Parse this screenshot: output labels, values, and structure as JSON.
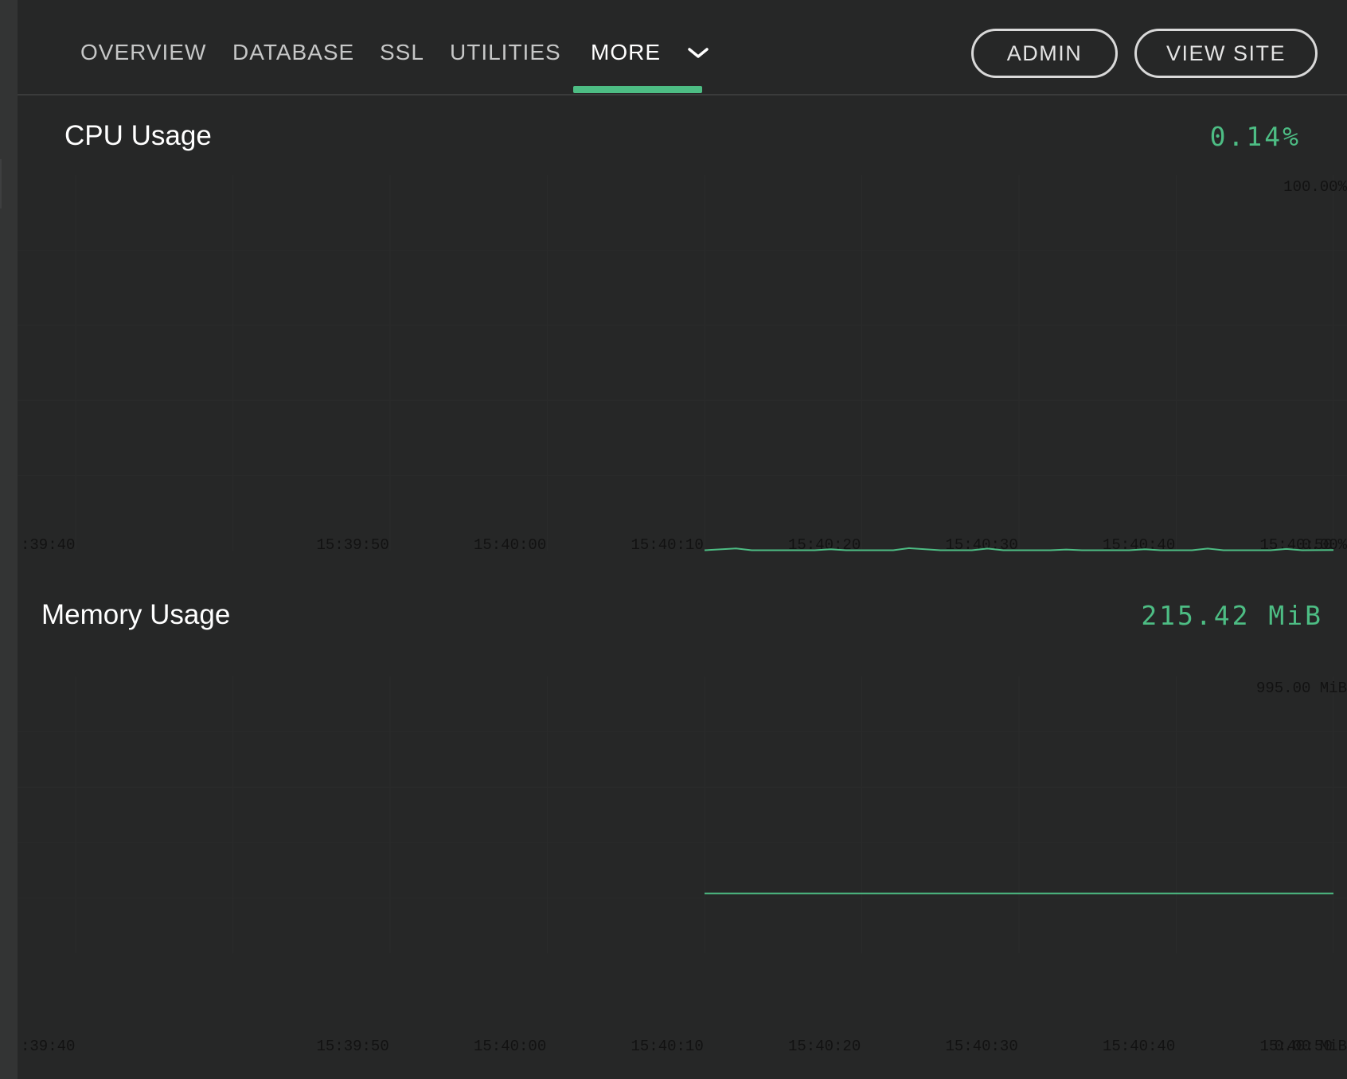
{
  "nav": {
    "tabs": [
      {
        "label": "OVERVIEW"
      },
      {
        "label": "DATABASE"
      },
      {
        "label": "SSL"
      },
      {
        "label": "UTILITIES"
      },
      {
        "label": "MORE"
      }
    ],
    "active_tab": "MORE",
    "admin_label": "ADMIN",
    "view_site_label": "VIEW SITE"
  },
  "colors": {
    "accent": "#4dbd84",
    "background": "#262727"
  },
  "cpu": {
    "title": "CPU Usage",
    "current": "0.14%"
  },
  "memory": {
    "title": "Memory Usage",
    "current": "215.42 MiB"
  },
  "chart_data": [
    {
      "type": "line",
      "title": "CPU Usage",
      "x": [
        ":39:40",
        "15:39:50",
        "15:40:00",
        "15:40:10",
        "15:40:20",
        "15:40:30",
        "15:40:40",
        "15:40:50"
      ],
      "y_labels": [
        "100.00%",
        "0.00%"
      ],
      "ylim": [
        0,
        100
      ],
      "unit": "%",
      "grid": true,
      "series": [
        {
          "points": [
            [
              "15:40:20.0",
              0.1
            ],
            [
              "15:40:22.0",
              0.6
            ],
            [
              "15:40:23.0",
              0.1
            ],
            [
              "15:40:27.0",
              0.1
            ],
            [
              "15:40:28.0",
              0.35
            ],
            [
              "15:40:29.0",
              0.1
            ],
            [
              "15:40:32.0",
              0.1
            ],
            [
              "15:40:33.0",
              0.65
            ],
            [
              "15:40:35.0",
              0.1
            ],
            [
              "15:40:37.0",
              0.1
            ],
            [
              "15:40:38.0",
              0.55
            ],
            [
              "15:40:39.0",
              0.1
            ],
            [
              "15:40:42.0",
              0.1
            ],
            [
              "15:40:43.0",
              0.3
            ],
            [
              "15:40:44.0",
              0.1
            ],
            [
              "15:40:47.0",
              0.1
            ],
            [
              "15:40:48.0",
              0.35
            ],
            [
              "15:40:49.0",
              0.1
            ],
            [
              "15:40:51.0",
              0.1
            ],
            [
              "15:40:52.0",
              0.55
            ],
            [
              "15:40:53.0",
              0.1
            ],
            [
              "15:40:56.0",
              0.1
            ],
            [
              "15:40:57.0",
              0.45
            ],
            [
              "15:40:58.0",
              0.1
            ],
            [
              "15:41:00.0",
              0.14
            ]
          ]
        }
      ]
    },
    {
      "type": "line",
      "title": "Memory Usage",
      "x": [
        ":39:40",
        "15:39:50",
        "15:40:00",
        "15:40:10",
        "15:40:20",
        "15:40:30",
        "15:40:40",
        "15:40:50"
      ],
      "y_labels": [
        "995.00 MiB",
        "0.00 MiB"
      ],
      "ylim": [
        0,
        995
      ],
      "unit": "MiB",
      "grid": true,
      "series": [
        {
          "points": [
            [
              "15:40:20.0",
              215.42
            ],
            [
              "15:41:00.0",
              215.42
            ]
          ]
        }
      ]
    }
  ]
}
